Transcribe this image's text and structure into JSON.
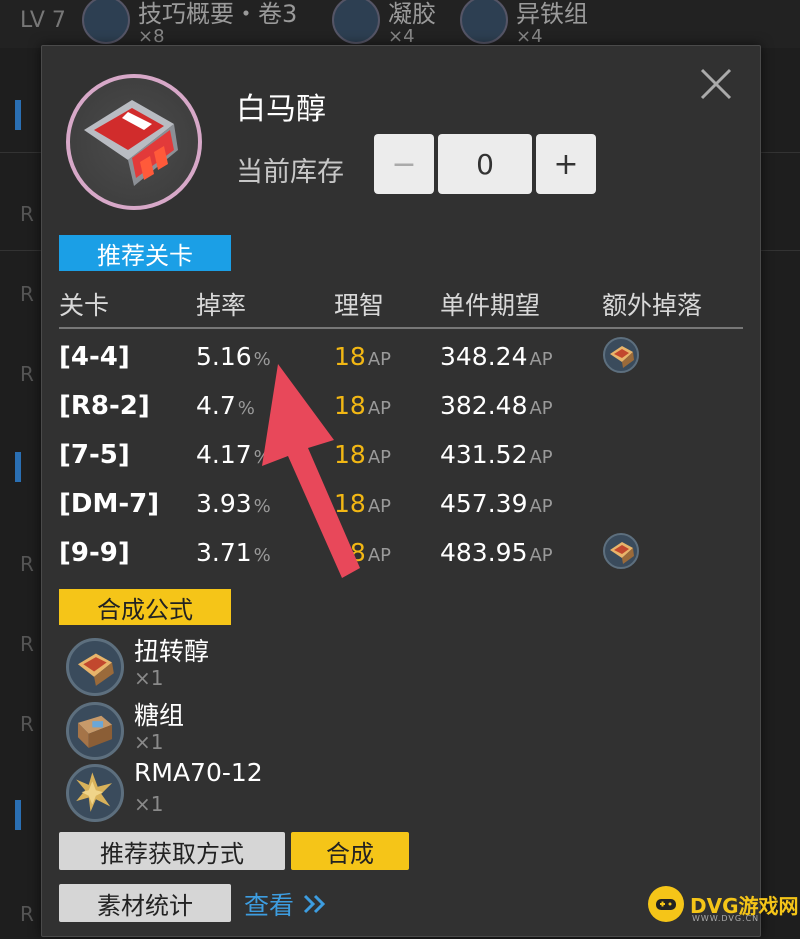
{
  "background": {
    "level": "LV 7",
    "items": [
      {
        "name": "技巧概要・卷3",
        "count": "×8"
      },
      {
        "name": "凝胶",
        "count": "×4"
      },
      {
        "name": "异铁组",
        "count": "×4"
      }
    ],
    "row_prefix": "R"
  },
  "modal": {
    "item_name": "白马醇",
    "stock_label": "当前库存",
    "stock_value": "0",
    "minus_label": "−",
    "plus_label": "+",
    "recommended_tag": "推荐关卡",
    "columns": [
      "关卡",
      "掉率",
      "理智",
      "单件期望",
      "额外掉落"
    ],
    "rows": [
      {
        "stage": "[4-4]",
        "rate": "5.16",
        "rate_unit": "%",
        "sanity": "18",
        "sanity_unit": "AP",
        "expect": "348.24",
        "expect_unit": "AP",
        "extra_drop": true
      },
      {
        "stage": "[R8-2]",
        "rate": "4.7",
        "rate_unit": "%",
        "sanity": "18",
        "sanity_unit": "AP",
        "expect": "382.48",
        "expect_unit": "AP",
        "extra_drop": false
      },
      {
        "stage": "[7-5]",
        "rate": "4.17",
        "rate_unit": "%",
        "sanity": "18",
        "sanity_unit": "AP",
        "expect": "431.52",
        "expect_unit": "AP",
        "extra_drop": false
      },
      {
        "stage": "[DM-7]",
        "rate": "3.93",
        "rate_unit": "%",
        "sanity": "18",
        "sanity_unit": "AP",
        "expect": "457.39",
        "expect_unit": "AP",
        "extra_drop": false
      },
      {
        "stage": "[9-9]",
        "rate": "3.71",
        "rate_unit": "%",
        "sanity": "18",
        "sanity_unit": "AP",
        "expect": "483.95",
        "expect_unit": "AP",
        "extra_drop": true
      }
    ],
    "formula_tag": "合成公式",
    "ingredients": [
      {
        "name": "扭转醇",
        "count": "×1",
        "icon": "twisted-alcohol-icon"
      },
      {
        "name": "糖组",
        "count": "×1",
        "icon": "sugar-pack-icon"
      },
      {
        "name": "RMA70-12",
        "count": "×1",
        "icon": "rma70-12-icon"
      }
    ],
    "acquire_button": "推荐获取方式",
    "craft_button": "合成",
    "stats_button": "素材统计",
    "view_link": "查看",
    "view_link_icon": "double-chevron-right-icon"
  },
  "watermark": {
    "text": "DVG游戏网",
    "sub": "WWW.DVG.CN"
  },
  "colors": {
    "accent_blue": "#1b9fe6",
    "accent_yellow": "#f5c518",
    "sanity": "#f2b714",
    "arrow": "#e8485a"
  }
}
